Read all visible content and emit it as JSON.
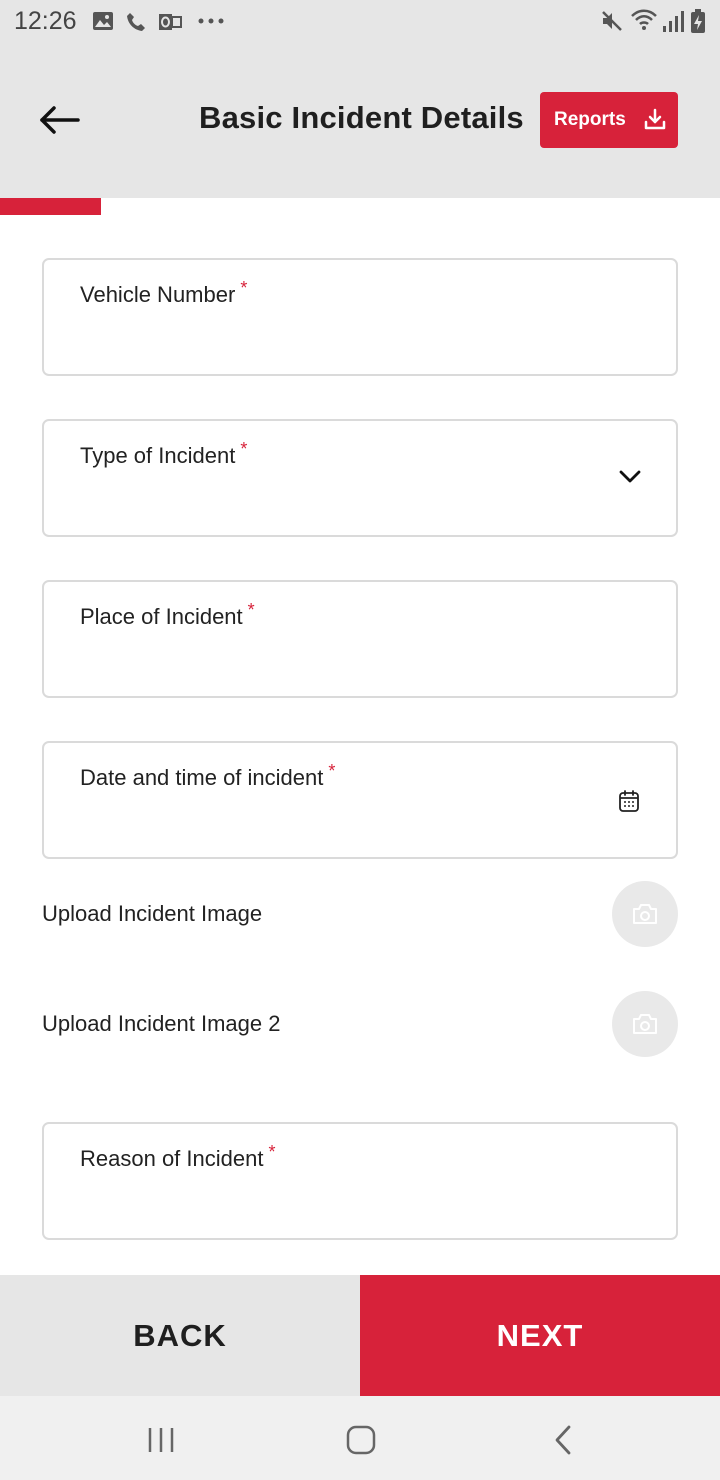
{
  "status_bar": {
    "time": "12:26",
    "left_icons": [
      "image-icon",
      "phone-icon",
      "outlook-icon",
      "more-icon"
    ],
    "right_icons": [
      "mute-icon",
      "wifi-icon",
      "signal-icon",
      "battery-icon"
    ]
  },
  "header": {
    "title": "Basic Incident Details",
    "reports_label": "Reports",
    "back_icon": "arrow-left-icon",
    "reports_icon": "download-icon"
  },
  "progress": {
    "fraction": 0.14
  },
  "form": {
    "required_mark": "*",
    "vehicle_number": {
      "label": "Vehicle Number",
      "value": ""
    },
    "type_of_incident": {
      "label": "Type of Incident",
      "value": ""
    },
    "place_of_incident": {
      "label": "Place of Incident",
      "value": ""
    },
    "date_time": {
      "label": "Date and time of incident",
      "value": ""
    },
    "upload_image_1": {
      "label": "Upload Incident Image"
    },
    "upload_image_2": {
      "label": "Upload Incident Image 2"
    },
    "reason_of_incident": {
      "label": "Reason of Incident",
      "value": ""
    }
  },
  "footer": {
    "back_label": "BACK",
    "next_label": "NEXT"
  },
  "colors": {
    "accent": "#d7223a",
    "header_bg": "#e6e6e6",
    "border": "#dadada"
  },
  "nav_bar": {
    "icons": [
      "recent-apps-icon",
      "home-icon",
      "system-back-icon"
    ]
  }
}
